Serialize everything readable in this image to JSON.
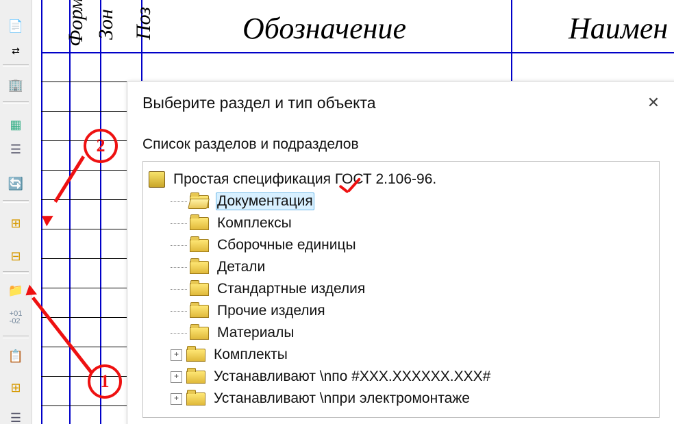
{
  "table_headers": {
    "format": "Форм",
    "zone": "Зон",
    "position": "Поз",
    "designation": "Обозначение",
    "name": "Наимен"
  },
  "dialog": {
    "title": "Выберите раздел и тип объекта",
    "subtitle": "Список разделов и подразделов",
    "close_glyph": "✕"
  },
  "tree": {
    "root": "Простая спецификация ГОСТ 2.106-96.",
    "items": [
      {
        "label": "Документация",
        "open": true,
        "expandable": false,
        "selected": true
      },
      {
        "label": "Комплексы",
        "open": false,
        "expandable": false
      },
      {
        "label": "Сборочные единицы",
        "open": false,
        "expandable": false
      },
      {
        "label": "Детали",
        "open": false,
        "expandable": false
      },
      {
        "label": "Стандартные изделия",
        "open": false,
        "expandable": false
      },
      {
        "label": "Прочие изделия",
        "open": false,
        "expandable": false
      },
      {
        "label": "Материалы",
        "open": false,
        "expandable": false
      },
      {
        "label": "Комплекты",
        "open": false,
        "expandable": true
      },
      {
        "label": "Устанавливают \\nпо #XXX.XXXXXX.XXX#",
        "open": false,
        "expandable": true
      },
      {
        "label": "Устанавливают \\nпри электромонтаже",
        "open": false,
        "expandable": true
      }
    ]
  },
  "annotations": {
    "badge1": "1",
    "badge2": "2"
  },
  "toolbar_icons": [
    {
      "name": "tool-doc",
      "glyph": "📄"
    },
    {
      "name": "tool-align",
      "glyph": "⇄"
    },
    {
      "name": "tool-props",
      "glyph": "🏠"
    },
    {
      "name": "tool-grid",
      "glyph": "▦"
    },
    {
      "name": "tool-rows",
      "glyph": "☰"
    },
    {
      "name": "tool-refresh",
      "glyph": "🔄"
    },
    {
      "name": "tool-addrow",
      "glyph": "⊞"
    },
    {
      "name": "tool-addcol",
      "glyph": "⊟"
    },
    {
      "name": "tool-newfolder",
      "glyph": "📁"
    },
    {
      "name": "tool-num",
      "glyph": "01"
    },
    {
      "name": "tool-copy",
      "glyph": "📋"
    },
    {
      "name": "tool-grid2",
      "glyph": "⊞"
    },
    {
      "name": "tool-list",
      "glyph": "☰"
    }
  ]
}
